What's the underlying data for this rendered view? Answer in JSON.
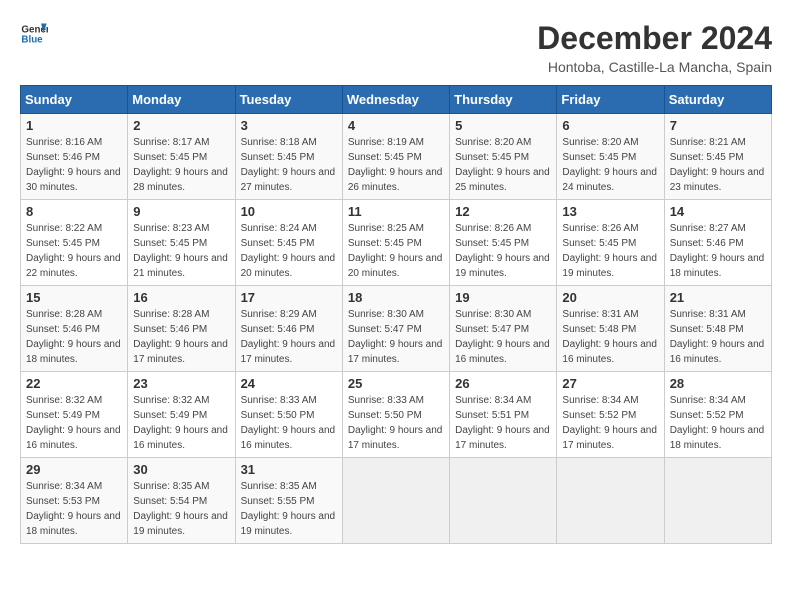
{
  "logo": {
    "line1": "General",
    "line2": "Blue"
  },
  "title": "December 2024",
  "subtitle": "Hontoba, Castille-La Mancha, Spain",
  "headers": [
    "Sunday",
    "Monday",
    "Tuesday",
    "Wednesday",
    "Thursday",
    "Friday",
    "Saturday"
  ],
  "weeks": [
    [
      {
        "day": "1",
        "sunrise": "Sunrise: 8:16 AM",
        "sunset": "Sunset: 5:46 PM",
        "daylight": "Daylight: 9 hours and 30 minutes."
      },
      {
        "day": "2",
        "sunrise": "Sunrise: 8:17 AM",
        "sunset": "Sunset: 5:45 PM",
        "daylight": "Daylight: 9 hours and 28 minutes."
      },
      {
        "day": "3",
        "sunrise": "Sunrise: 8:18 AM",
        "sunset": "Sunset: 5:45 PM",
        "daylight": "Daylight: 9 hours and 27 minutes."
      },
      {
        "day": "4",
        "sunrise": "Sunrise: 8:19 AM",
        "sunset": "Sunset: 5:45 PM",
        "daylight": "Daylight: 9 hours and 26 minutes."
      },
      {
        "day": "5",
        "sunrise": "Sunrise: 8:20 AM",
        "sunset": "Sunset: 5:45 PM",
        "daylight": "Daylight: 9 hours and 25 minutes."
      },
      {
        "day": "6",
        "sunrise": "Sunrise: 8:20 AM",
        "sunset": "Sunset: 5:45 PM",
        "daylight": "Daylight: 9 hours and 24 minutes."
      },
      {
        "day": "7",
        "sunrise": "Sunrise: 8:21 AM",
        "sunset": "Sunset: 5:45 PM",
        "daylight": "Daylight: 9 hours and 23 minutes."
      }
    ],
    [
      {
        "day": "8",
        "sunrise": "Sunrise: 8:22 AM",
        "sunset": "Sunset: 5:45 PM",
        "daylight": "Daylight: 9 hours and 22 minutes."
      },
      {
        "day": "9",
        "sunrise": "Sunrise: 8:23 AM",
        "sunset": "Sunset: 5:45 PM",
        "daylight": "Daylight: 9 hours and 21 minutes."
      },
      {
        "day": "10",
        "sunrise": "Sunrise: 8:24 AM",
        "sunset": "Sunset: 5:45 PM",
        "daylight": "Daylight: 9 hours and 20 minutes."
      },
      {
        "day": "11",
        "sunrise": "Sunrise: 8:25 AM",
        "sunset": "Sunset: 5:45 PM",
        "daylight": "Daylight: 9 hours and 20 minutes."
      },
      {
        "day": "12",
        "sunrise": "Sunrise: 8:26 AM",
        "sunset": "Sunset: 5:45 PM",
        "daylight": "Daylight: 9 hours and 19 minutes."
      },
      {
        "day": "13",
        "sunrise": "Sunrise: 8:26 AM",
        "sunset": "Sunset: 5:45 PM",
        "daylight": "Daylight: 9 hours and 19 minutes."
      },
      {
        "day": "14",
        "sunrise": "Sunrise: 8:27 AM",
        "sunset": "Sunset: 5:46 PM",
        "daylight": "Daylight: 9 hours and 18 minutes."
      }
    ],
    [
      {
        "day": "15",
        "sunrise": "Sunrise: 8:28 AM",
        "sunset": "Sunset: 5:46 PM",
        "daylight": "Daylight: 9 hours and 18 minutes."
      },
      {
        "day": "16",
        "sunrise": "Sunrise: 8:28 AM",
        "sunset": "Sunset: 5:46 PM",
        "daylight": "Daylight: 9 hours and 17 minutes."
      },
      {
        "day": "17",
        "sunrise": "Sunrise: 8:29 AM",
        "sunset": "Sunset: 5:46 PM",
        "daylight": "Daylight: 9 hours and 17 minutes."
      },
      {
        "day": "18",
        "sunrise": "Sunrise: 8:30 AM",
        "sunset": "Sunset: 5:47 PM",
        "daylight": "Daylight: 9 hours and 17 minutes."
      },
      {
        "day": "19",
        "sunrise": "Sunrise: 8:30 AM",
        "sunset": "Sunset: 5:47 PM",
        "daylight": "Daylight: 9 hours and 16 minutes."
      },
      {
        "day": "20",
        "sunrise": "Sunrise: 8:31 AM",
        "sunset": "Sunset: 5:48 PM",
        "daylight": "Daylight: 9 hours and 16 minutes."
      },
      {
        "day": "21",
        "sunrise": "Sunrise: 8:31 AM",
        "sunset": "Sunset: 5:48 PM",
        "daylight": "Daylight: 9 hours and 16 minutes."
      }
    ],
    [
      {
        "day": "22",
        "sunrise": "Sunrise: 8:32 AM",
        "sunset": "Sunset: 5:49 PM",
        "daylight": "Daylight: 9 hours and 16 minutes."
      },
      {
        "day": "23",
        "sunrise": "Sunrise: 8:32 AM",
        "sunset": "Sunset: 5:49 PM",
        "daylight": "Daylight: 9 hours and 16 minutes."
      },
      {
        "day": "24",
        "sunrise": "Sunrise: 8:33 AM",
        "sunset": "Sunset: 5:50 PM",
        "daylight": "Daylight: 9 hours and 16 minutes."
      },
      {
        "day": "25",
        "sunrise": "Sunrise: 8:33 AM",
        "sunset": "Sunset: 5:50 PM",
        "daylight": "Daylight: 9 hours and 17 minutes."
      },
      {
        "day": "26",
        "sunrise": "Sunrise: 8:34 AM",
        "sunset": "Sunset: 5:51 PM",
        "daylight": "Daylight: 9 hours and 17 minutes."
      },
      {
        "day": "27",
        "sunrise": "Sunrise: 8:34 AM",
        "sunset": "Sunset: 5:52 PM",
        "daylight": "Daylight: 9 hours and 17 minutes."
      },
      {
        "day": "28",
        "sunrise": "Sunrise: 8:34 AM",
        "sunset": "Sunset: 5:52 PM",
        "daylight": "Daylight: 9 hours and 18 minutes."
      }
    ],
    [
      {
        "day": "29",
        "sunrise": "Sunrise: 8:34 AM",
        "sunset": "Sunset: 5:53 PM",
        "daylight": "Daylight: 9 hours and 18 minutes."
      },
      {
        "day": "30",
        "sunrise": "Sunrise: 8:35 AM",
        "sunset": "Sunset: 5:54 PM",
        "daylight": "Daylight: 9 hours and 19 minutes."
      },
      {
        "day": "31",
        "sunrise": "Sunrise: 8:35 AM",
        "sunset": "Sunset: 5:55 PM",
        "daylight": "Daylight: 9 hours and 19 minutes."
      },
      null,
      null,
      null,
      null
    ]
  ]
}
